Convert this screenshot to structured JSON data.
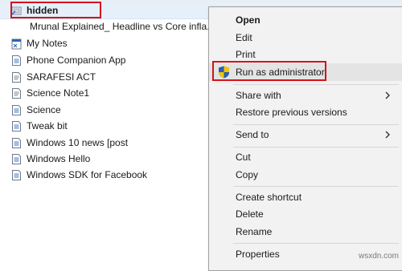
{
  "files": [
    {
      "name": "hidden",
      "icon": "folder-shortcut-icon",
      "selected": true
    },
    {
      "name": "Mrunal Explained_ Headline vs Core infla...",
      "icon": "none"
    },
    {
      "name": "My Notes",
      "icon": "notes-app-icon"
    },
    {
      "name": "Phone Companion App",
      "icon": "document-icon"
    },
    {
      "name": "SARAFESI ACT",
      "icon": "text-file-icon"
    },
    {
      "name": "Science Note1",
      "icon": "text-file-icon"
    },
    {
      "name": "Science",
      "icon": "document-icon"
    },
    {
      "name": "Tweak bit",
      "icon": "document-icon"
    },
    {
      "name": "Windows 10 news [post",
      "icon": "document-icon"
    },
    {
      "name": "Windows Hello",
      "icon": "document-icon"
    },
    {
      "name": "Windows SDK for Facebook",
      "icon": "document-icon"
    }
  ],
  "context_menu": {
    "open": "Open",
    "edit": "Edit",
    "print": "Print",
    "run_as_admin": "Run as administrator",
    "share_with": "Share with",
    "restore_previous_versions": "Restore previous versions",
    "send_to": "Send to",
    "cut": "Cut",
    "copy": "Copy",
    "create_shortcut": "Create shortcut",
    "delete": "Delete",
    "rename": "Rename",
    "properties": "Properties"
  },
  "colors": {
    "highlight_border": "#d3131b",
    "selection_bg": "#e5f0fb",
    "menu_bg": "#f2f2f2",
    "menu_hover": "#e4e4e4"
  },
  "watermark": "wsxdn.com"
}
